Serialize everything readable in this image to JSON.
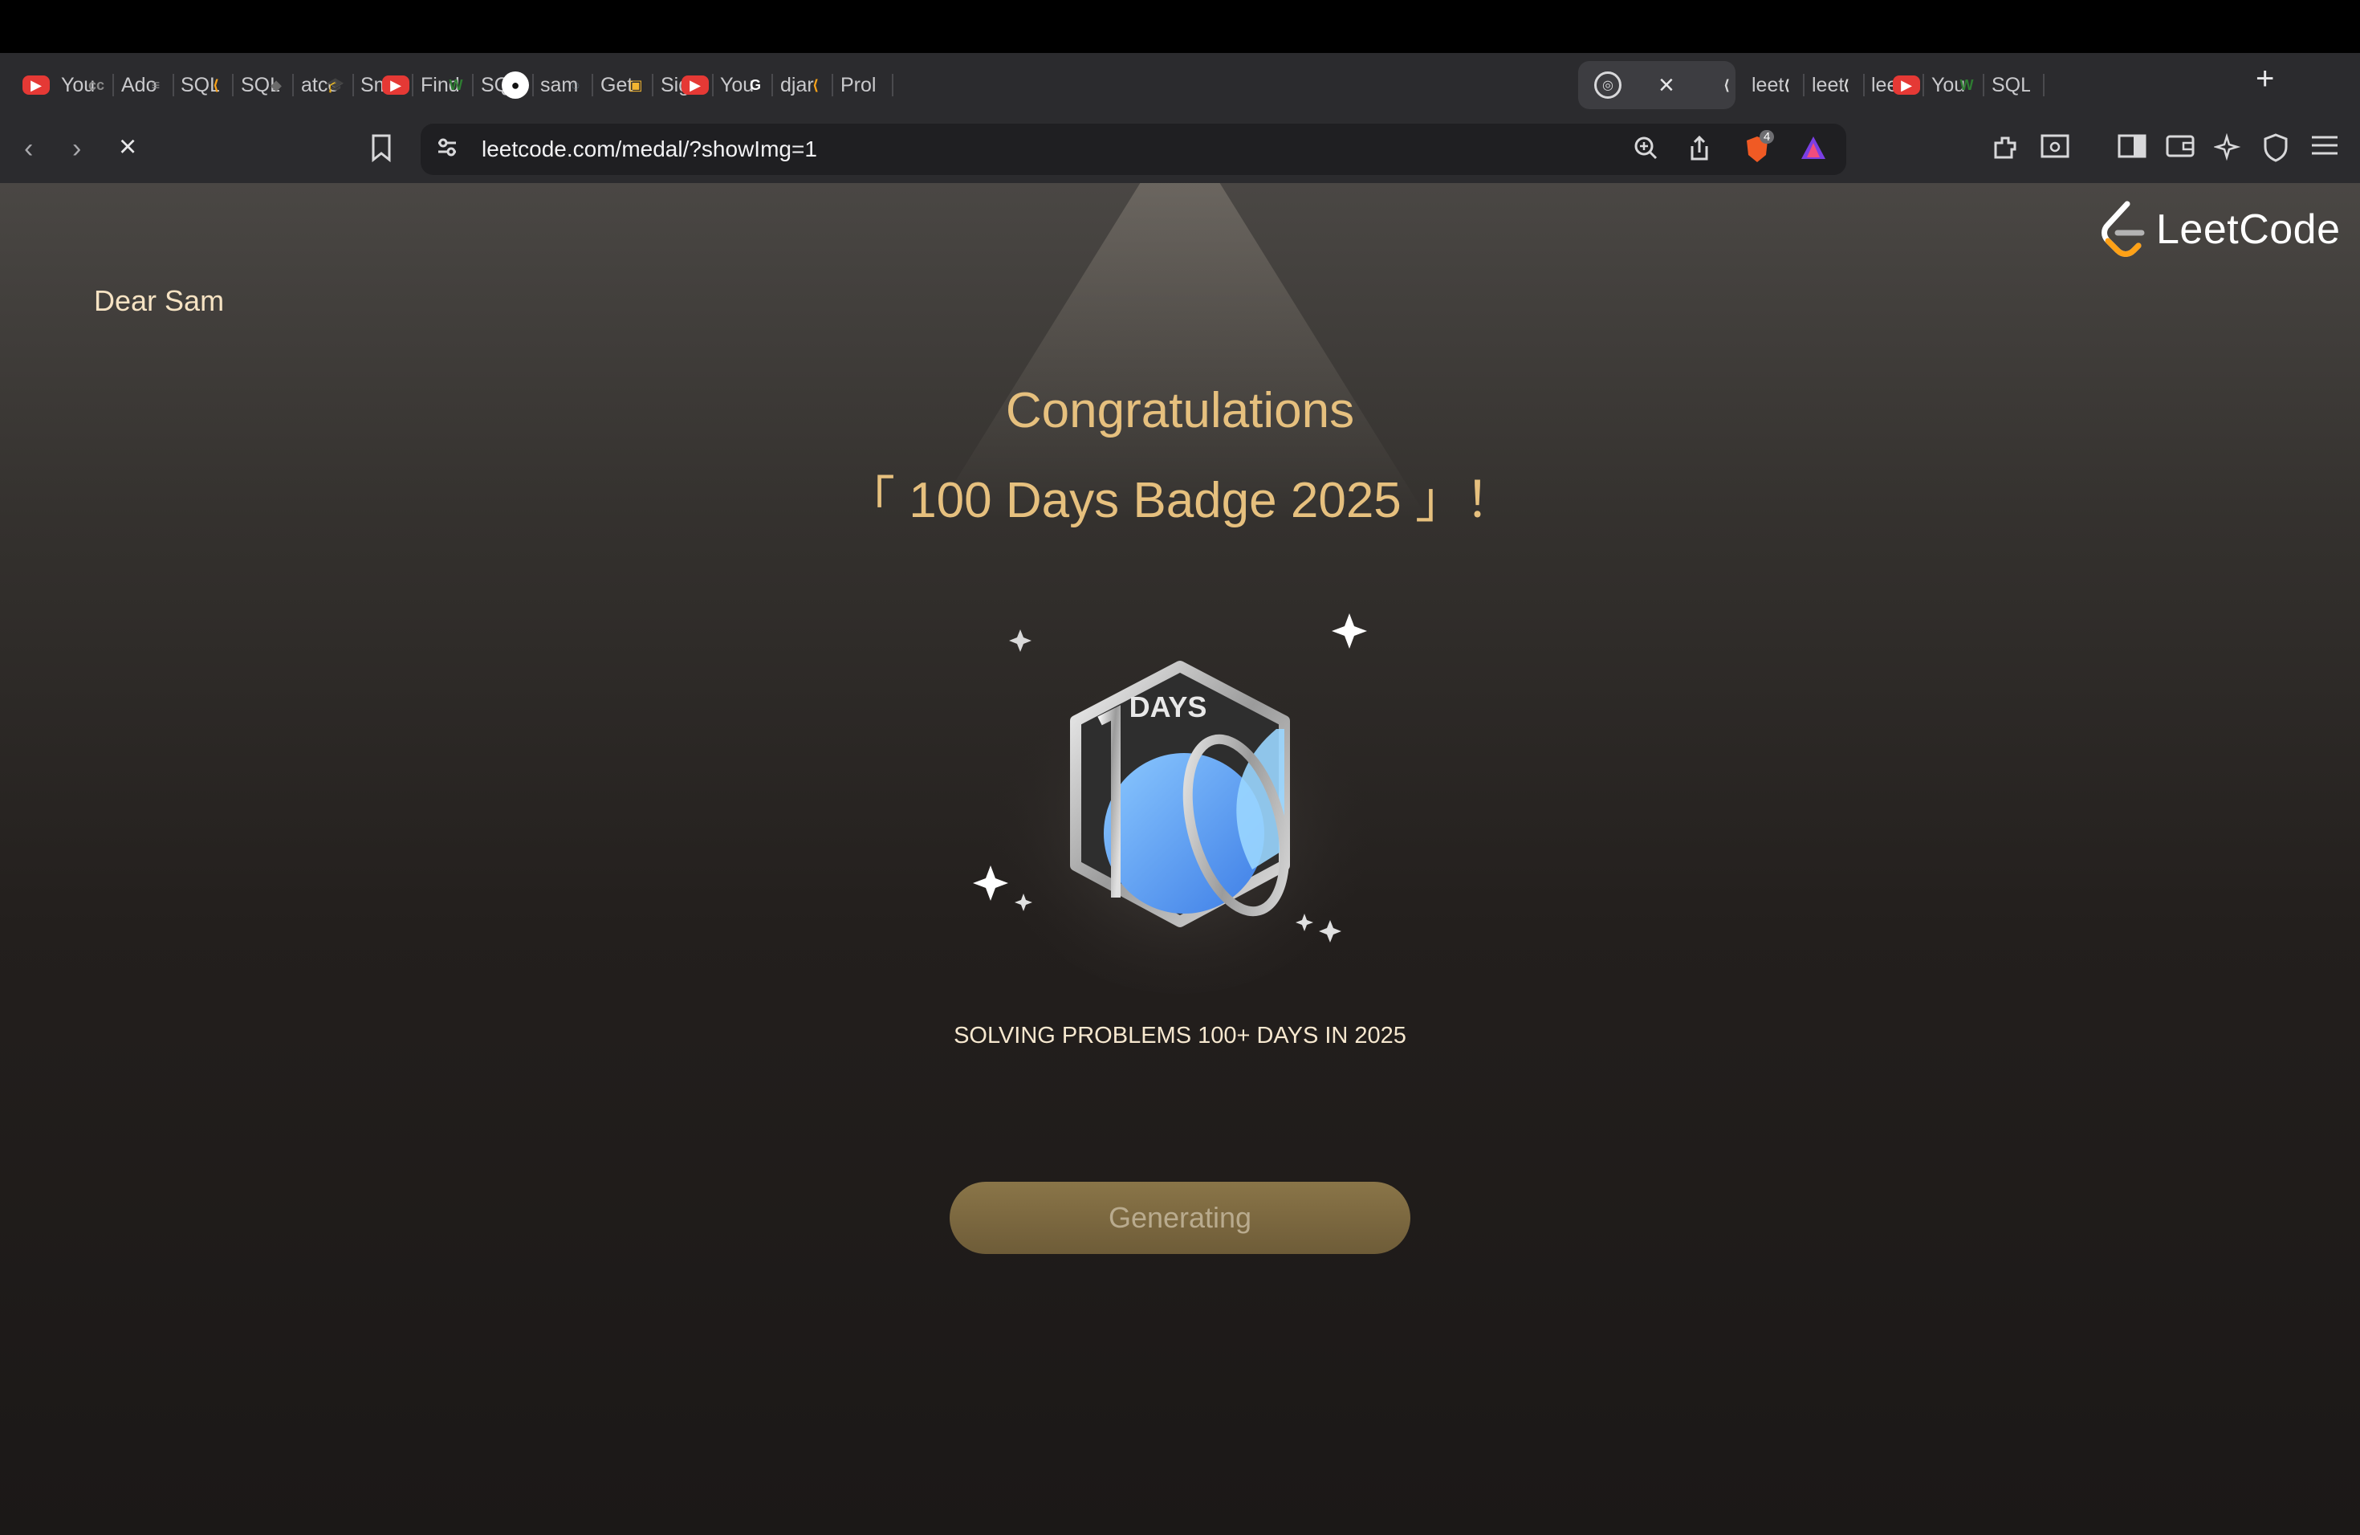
{
  "browser": {
    "tabs": [
      {
        "label": "You",
        "icon": "youtube-icon",
        "color": "#e53935"
      },
      {
        "label": "Ado",
        "icon": "cc-icon",
        "color": "#8a8a8a"
      },
      {
        "label": "SQL",
        "icon": "sql-icon",
        "color": "#8a8a8a"
      },
      {
        "label": "SQL",
        "icon": "leetcode-icon",
        "color": "#f7a21b"
      },
      {
        "label": "atco",
        "icon": "atcoder-icon",
        "color": "#6a6a6a"
      },
      {
        "label": "Smo",
        "icon": "graduation-icon",
        "color": "#4a5ad8"
      },
      {
        "label": "Find",
        "icon": "youtube-icon",
        "color": "#e53935"
      },
      {
        "label": "SQL",
        "icon": "w-icon",
        "color": "#2e7d32"
      },
      {
        "label": "sam",
        "icon": "github-icon",
        "color": "#ffffff"
      },
      {
        "label": "Get",
        "icon": "circle-icon",
        "color": "#607d8b"
      },
      {
        "label": "Sign",
        "icon": "box-icon",
        "color": "#f2b531"
      },
      {
        "label": "You",
        "icon": "youtube-icon",
        "color": "#e53935"
      },
      {
        "label": "djar",
        "icon": "google-icon",
        "color": "#ffffff"
      },
      {
        "label": "Prol",
        "icon": "leetcode-icon",
        "color": "#f7a21b"
      }
    ],
    "active_tab": {
      "icon": "spinner-icon"
    },
    "tabs_after": [
      {
        "label": "leet",
        "icon": "leetcode-icon",
        "color": "#d8d8d8"
      },
      {
        "label": "leet",
        "icon": "leetcode-icon",
        "color": "#d8d8d8"
      },
      {
        "label": "leet",
        "icon": "leetcode-icon",
        "color": "#d8d8d8"
      },
      {
        "label": "You",
        "icon": "youtube-icon",
        "color": "#e53935"
      },
      {
        "label": "SQL",
        "icon": "w-icon",
        "color": "#2e7d32"
      }
    ],
    "url": "leetcode.com/medal/?showImg=1",
    "shield_count": "4"
  },
  "page": {
    "logo_text": "LeetCode",
    "greeting": "Dear Sam",
    "congrats": "Congratulations",
    "badge_title": "「 100 Days Badge 2025 」！",
    "badge_label": "DAYS",
    "badge_description": "SOLVING PROBLEMS 100+ DAYS IN 2025",
    "button_label": "Generating",
    "accent_color": "#e6c07e"
  }
}
